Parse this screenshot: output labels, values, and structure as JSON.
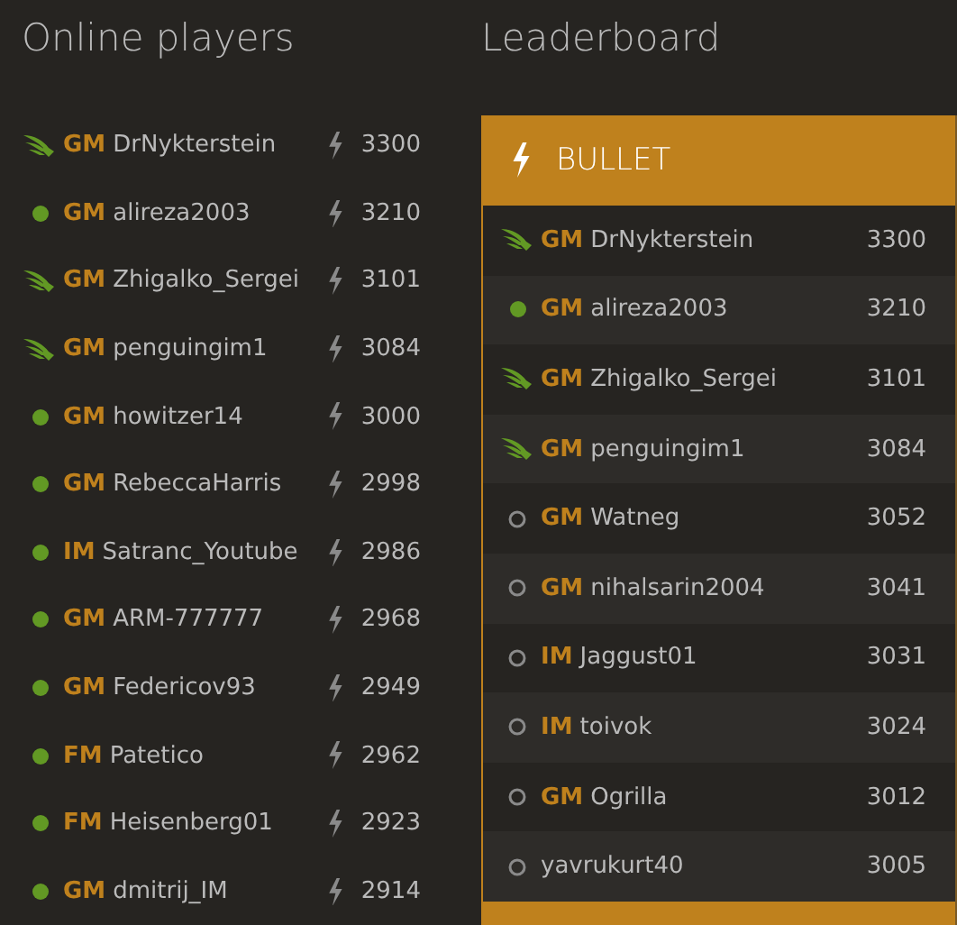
{
  "online_players": {
    "title": "Online players",
    "players": [
      {
        "kind": "patron",
        "title": "GM",
        "name": "DrNykterstein",
        "rating": "3300"
      },
      {
        "kind": "online",
        "title": "GM",
        "name": "alireza2003",
        "rating": "3210"
      },
      {
        "kind": "patron",
        "title": "GM",
        "name": "Zhigalko_Sergei",
        "rating": "3101"
      },
      {
        "kind": "patron",
        "title": "GM",
        "name": "penguingim1",
        "rating": "3084"
      },
      {
        "kind": "online",
        "title": "GM",
        "name": "howitzer14",
        "rating": "3000"
      },
      {
        "kind": "online",
        "title": "GM",
        "name": "RebeccaHarris",
        "rating": "2998"
      },
      {
        "kind": "online",
        "title": "IM",
        "name": "Satranc_Youtube",
        "rating": "2986"
      },
      {
        "kind": "online",
        "title": "GM",
        "name": "ARM-777777",
        "rating": "2968"
      },
      {
        "kind": "online",
        "title": "GM",
        "name": "Federicov93",
        "rating": "2949"
      },
      {
        "kind": "online",
        "title": "FM",
        "name": "Patetico",
        "rating": "2962"
      },
      {
        "kind": "online",
        "title": "FM",
        "name": "Heisenberg01",
        "rating": "2923"
      },
      {
        "kind": "online",
        "title": "GM",
        "name": "dmitrij_IM",
        "rating": "2914"
      }
    ]
  },
  "leaderboard": {
    "title": "Leaderboard",
    "panel_title": "BULLET",
    "players": [
      {
        "kind": "patron",
        "title": "GM",
        "name": "DrNykterstein",
        "rating": "3300"
      },
      {
        "kind": "online",
        "title": "GM",
        "name": "alireza2003",
        "rating": "3210"
      },
      {
        "kind": "patron",
        "title": "GM",
        "name": "Zhigalko_Sergei",
        "rating": "3101"
      },
      {
        "kind": "patron",
        "title": "GM",
        "name": "penguingim1",
        "rating": "3084"
      },
      {
        "kind": "offline",
        "title": "GM",
        "name": "Watneg",
        "rating": "3052"
      },
      {
        "kind": "offline",
        "title": "GM",
        "name": "nihalsarin2004",
        "rating": "3041"
      },
      {
        "kind": "offline",
        "title": "IM",
        "name": "Jaggust01",
        "rating": "3031"
      },
      {
        "kind": "offline",
        "title": "IM",
        "name": "toivok",
        "rating": "3024"
      },
      {
        "kind": "offline",
        "title": "GM",
        "name": "Ogrilla",
        "rating": "3012"
      },
      {
        "kind": "offline",
        "name": "yavrukurt40",
        "rating": "3005"
      }
    ]
  }
}
